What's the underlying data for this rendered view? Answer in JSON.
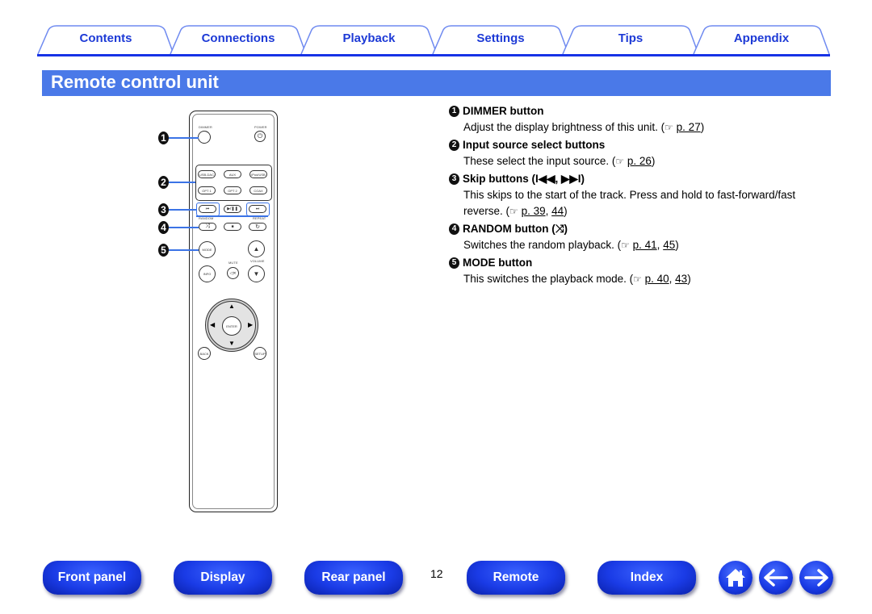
{
  "tabs": [
    {
      "label": "Contents"
    },
    {
      "label": "Connections"
    },
    {
      "label": "Playback"
    },
    {
      "label": "Settings"
    },
    {
      "label": "Tips"
    },
    {
      "label": "Appendix"
    }
  ],
  "section_title": "Remote control unit",
  "remote": {
    "labels": {
      "dimmer": "DIMMER",
      "power": "POWER",
      "usb_dac": "USB-DAC",
      "aux": "AUX",
      "ipod_usb": "iPod/USB",
      "opt1": "OPT 1",
      "opt2": "OPT 2",
      "coax": "COAX",
      "random": "RANDOM",
      "repeat": "REPEAT",
      "mode": "MODE",
      "info": "INFO",
      "mute": "MUTE",
      "volume": "VOLUME",
      "enter": "ENTER",
      "back": "BACK",
      "setup": "SETUP"
    },
    "glyphs": {
      "power": "⏻",
      "prev": "⏮",
      "play_pause": "▶/❚❚",
      "next": "⏭",
      "random": "⤨",
      "stop": "■",
      "repeat": "↻",
      "vol_up": "▲",
      "vol_down": "▼",
      "mute": "◁✕",
      "up": "▲",
      "down": "▼",
      "left": "◀",
      "right": "▶"
    },
    "callouts": [
      "1",
      "2",
      "3",
      "4",
      "5"
    ]
  },
  "items": [
    {
      "num": "1",
      "title": "DIMMER button",
      "text": "Adjust the display brightness of this unit.",
      "refs": [
        "p. 27"
      ]
    },
    {
      "num": "2",
      "title": "Input source select buttons",
      "text": "These select the input source.",
      "refs": [
        "p. 26"
      ]
    },
    {
      "num": "3",
      "title": "Skip buttons (I◀◀, ▶▶I)",
      "text": "This skips to the start of the track. Press and hold to fast-forward/fast reverse.",
      "refs": [
        "p. 39",
        "44"
      ]
    },
    {
      "num": "4",
      "title": "RANDOM button (⤨)",
      "text": "Switches the random playback.",
      "refs": [
        "p. 41",
        "45"
      ]
    },
    {
      "num": "5",
      "title": "MODE button",
      "text": "This switches the playback mode.",
      "refs": [
        "p. 40",
        "43"
      ]
    }
  ],
  "ref_icon": "☞",
  "bottom_nav": {
    "front_panel": "Front panel",
    "display": "Display",
    "rear_panel": "Rear panel",
    "page_number": "12",
    "remote": "Remote",
    "index": "Index"
  },
  "colors": {
    "accent": "#1d3ad6",
    "title_bar": "#4a79e8",
    "callout": "#3b73e6"
  }
}
